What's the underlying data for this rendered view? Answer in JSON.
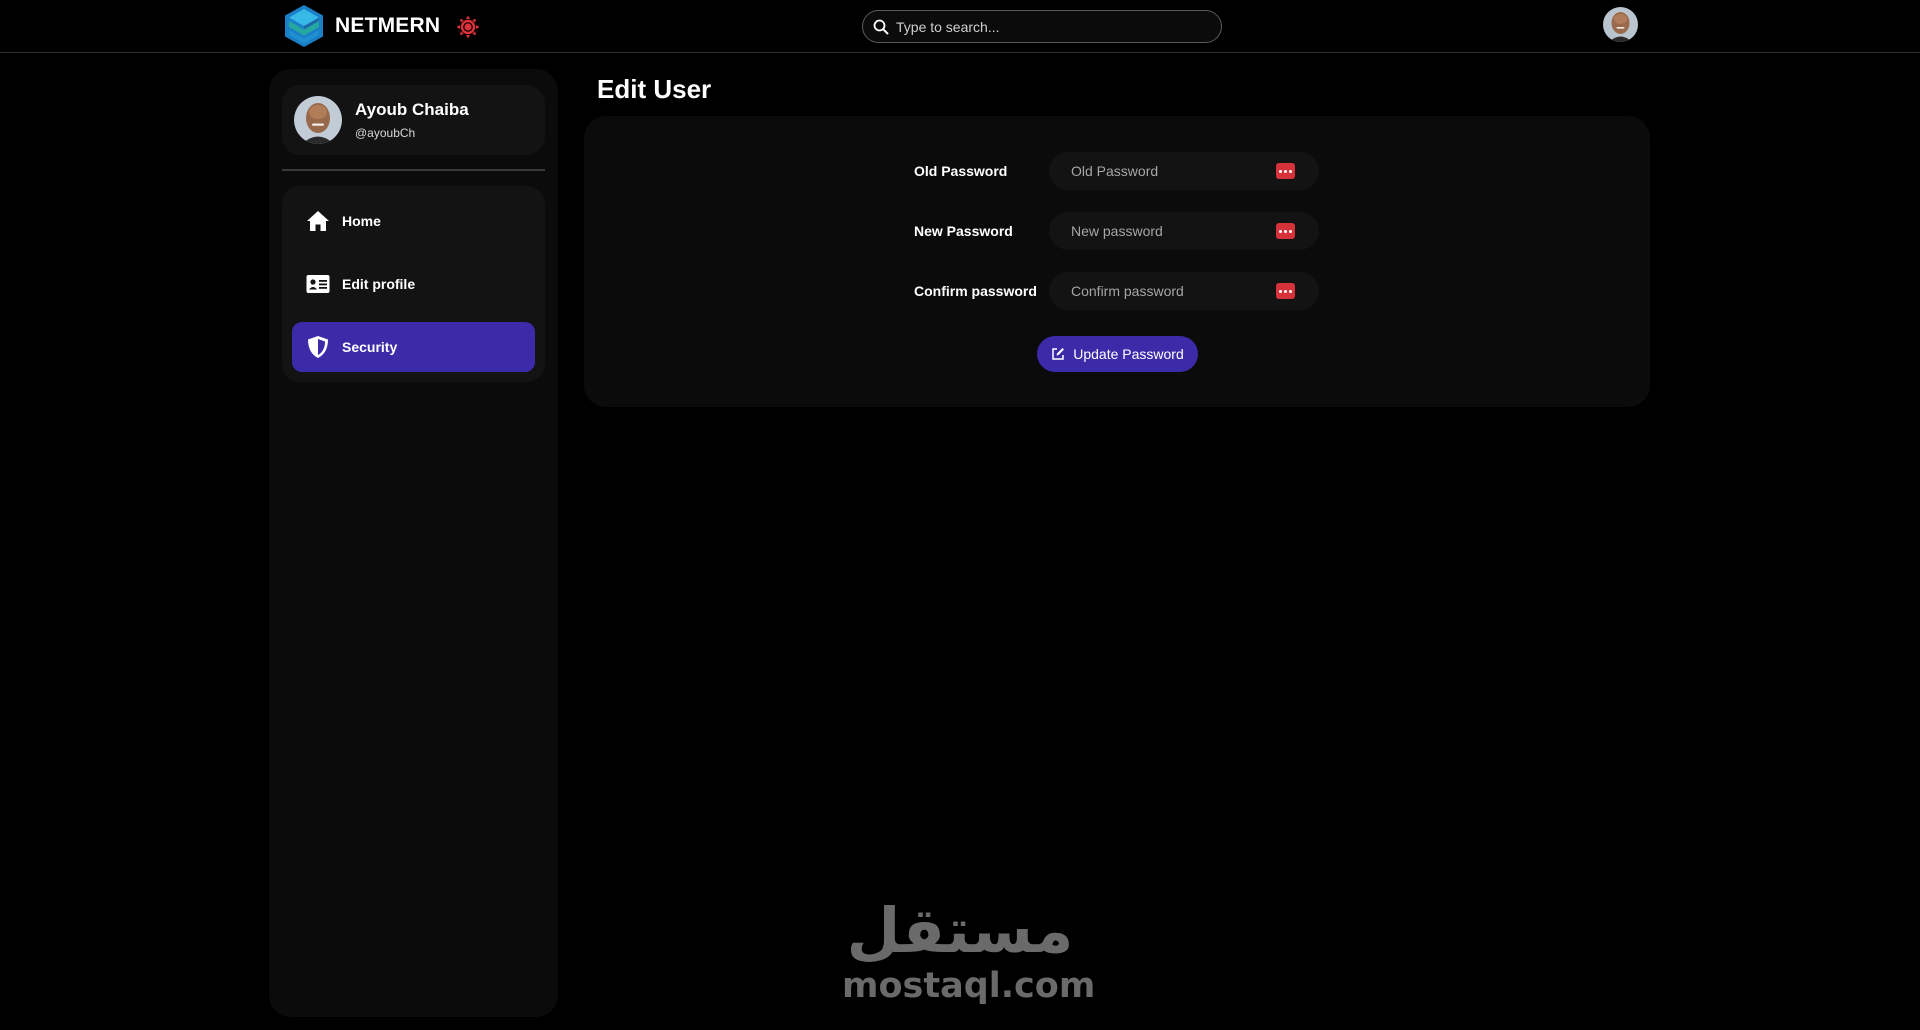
{
  "app": {
    "name": "NETMERN"
  },
  "header": {
    "search_placeholder": "Type to search..."
  },
  "sidebar": {
    "profile": {
      "name": "Ayoub Chaiba",
      "handle": "@ayoubCh"
    },
    "items": [
      {
        "label": "Home",
        "icon": "home-icon",
        "active": false
      },
      {
        "label": "Edit profile",
        "icon": "id-card-icon",
        "active": false
      },
      {
        "label": "Security",
        "icon": "shield-icon",
        "active": true
      }
    ]
  },
  "main": {
    "title": "Edit User",
    "form": {
      "old_password": {
        "label": "Old Password",
        "placeholder": "Old Password",
        "value": ""
      },
      "new_password": {
        "label": "New Password",
        "placeholder": "New password",
        "value": ""
      },
      "confirm_password": {
        "label": "Confirm password",
        "placeholder": "Confirm password",
        "value": ""
      },
      "submit_label": "Update Password"
    }
  },
  "watermark": {
    "arabic": "مستقل",
    "latin": "mostaql.com"
  },
  "colors": {
    "background": "#000000",
    "panel": "#0b0b0b",
    "card": "#131313",
    "accent": "#3c2ba9",
    "key_badge": "#d6323a",
    "theme_icon": "#e0313a"
  }
}
